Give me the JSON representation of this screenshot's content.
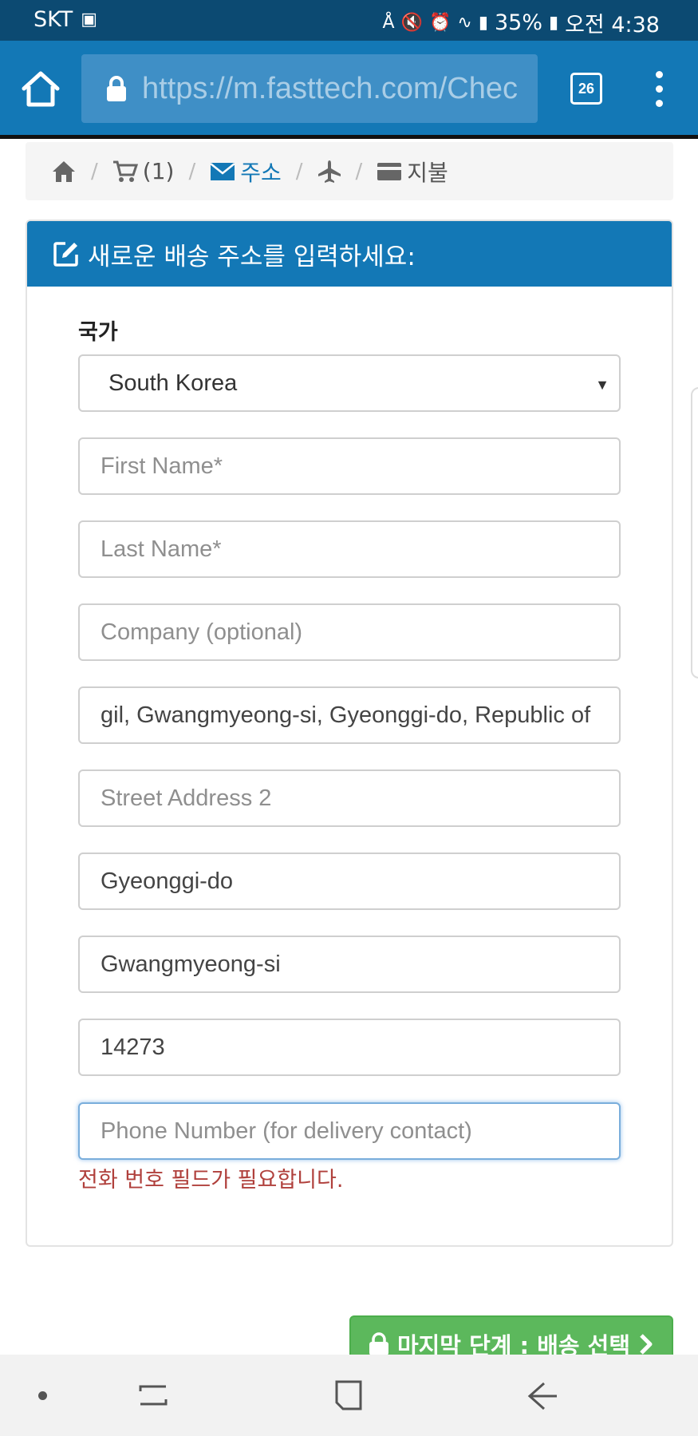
{
  "status_bar": {
    "carrier": "SKT",
    "battery": "35%",
    "time": "오전 4:38"
  },
  "browser": {
    "url": "https://m.fasttech.com/Chec",
    "tab_count": "26"
  },
  "breadcrumb": {
    "cart_count": "(1)",
    "address_label": "주소",
    "payment_label": "지불"
  },
  "panel": {
    "title": "새로운 배송 주소를 입력하세요:"
  },
  "form": {
    "country_label": "국가",
    "country_value": "South Korea",
    "first_name_placeholder": "First Name*",
    "last_name_placeholder": "Last Name*",
    "company_placeholder": "Company (optional)",
    "street1_value": "gil, Gwangmyeong-si, Gyeonggi-do, Republic of K",
    "street2_placeholder": "Street Address 2",
    "state_value": "Gyeonggi-do",
    "city_value": "Gwangmyeong-si",
    "zip_value": "14273",
    "phone_placeholder": "Phone Number (for delivery contact)",
    "phone_error": "전화 번호 필드가 필요합니다."
  },
  "next_button": {
    "label": "마지막 단계 : 배송 선택"
  },
  "colors": {
    "header_blue": "#1378b6",
    "status_bar_blue": "#0c4a72",
    "error_red": "#b0403c",
    "button_green": "#5cb85c"
  }
}
